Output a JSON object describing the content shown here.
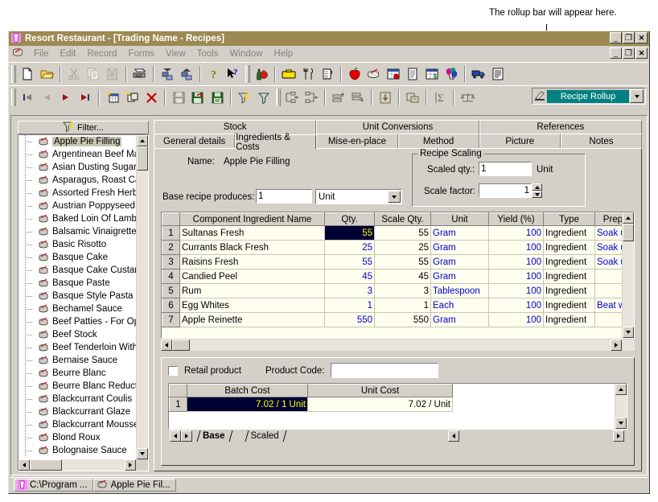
{
  "annotation": "The rollup bar will appear here.",
  "window": {
    "title": "Resort Restaurant - [Trading Name - Recipes]",
    "minimize": "_",
    "restore": "❐",
    "close": "✕"
  },
  "menu": {
    "items": [
      "File",
      "Edit",
      "Record",
      "Forms",
      "View",
      "Tools",
      "Window",
      "Help"
    ],
    "minimize": "_",
    "restore": "❐",
    "close": "✕"
  },
  "toolbar1": {
    "icons": [
      "new-document-icon",
      "open-folder-icon",
      "cut-scissors-icon",
      "copy-icon",
      "paste-icon",
      "print-preview-icon",
      "move-down-icon",
      "move-up-icon",
      "help-question-icon",
      "help-pointer-icon",
      "beverage-icon",
      "stock-box-icon",
      "cutlery-icon",
      "measuring-jug-icon",
      "apple-icon",
      "mixing-bowl-icon",
      "recipe-calendar-icon",
      "menu-book-icon",
      "cost-sheet-icon",
      "balloons-icon",
      "delivery-truck-icon",
      "report-icon"
    ]
  },
  "toolbar2": {
    "icons": [
      "first-record-icon",
      "previous-record-icon",
      "next-record-icon",
      "last-record-icon",
      "new-record-icon",
      "duplicate-record-icon",
      "delete-record-icon",
      "save-icon",
      "save-undo-icon",
      "save-print-icon",
      "filter-apply-icon",
      "filter-icon",
      "indent-left-icon",
      "indent-right-icon",
      "promote-icon",
      "demote-icon",
      "download-icon",
      "properties-icon",
      "sum-icon",
      "balance-icon"
    ]
  },
  "rollup": {
    "label": "Recipe Rollup",
    "dropdown": "↓",
    "icon": "rollup-pen-icon"
  },
  "tree": {
    "filter_label": "Filter...",
    "filter_icon": "filter-funnel-icon",
    "selected": "Apple Pie Filling",
    "items": [
      "Apple Pie Filling",
      "Argentinean Beef Matambre",
      "Asian Dusting Sugar",
      "Asparagus, Roast Capsicum",
      "Assorted Fresh Herbs, Fine",
      "Austrian Poppyseed Cake",
      "Baked Loin Of Lamb With C",
      "Balsamic Vinaigrette",
      "Basic Risotto",
      "Basque Cake",
      "Basque Cake Custard Filling",
      "Basque Paste",
      "Basque Style Pasta Piperad",
      "Bechamel Sauce",
      "Beef Patties - For Open Fac",
      "Beef Stock",
      "Beef Tenderloin With Seed",
      "Bernaise Sauce",
      "Beurre Blanc",
      "Beurre Blanc Reduction",
      "Blackcurrant Coulis",
      "Blackcurrant Glaze",
      "Blackcurrant Mousse",
      "Blond Roux",
      "Bolognaise Sauce"
    ]
  },
  "tabs_row1": [
    {
      "label": "Stock",
      "active": false
    },
    {
      "label": "Unit Conversions",
      "active": false
    },
    {
      "label": "References",
      "active": false
    }
  ],
  "tabs_row2": [
    {
      "label": "General details",
      "active": false
    },
    {
      "label": "Ingredients & Costs",
      "active": true
    },
    {
      "label": "Mise-en-place",
      "active": false
    },
    {
      "label": "Method",
      "active": false
    },
    {
      "label": "Picture",
      "active": false
    },
    {
      "label": "Notes",
      "active": false
    }
  ],
  "form": {
    "name_label": "Name:",
    "name_value": "Apple Pie Filling",
    "base_recipe_label": "Base recipe produces:",
    "base_recipe_qty": "1",
    "base_recipe_unit": "Unit",
    "scaling_title": "Recipe Scaling",
    "scaled_qty_label": "Scaled qty.:",
    "scaled_qty_value": "1",
    "scaled_qty_unit": "Unit",
    "scale_factor_label": "Scale factor:",
    "scale_factor_value": "1"
  },
  "grid": {
    "columns": [
      "Component Ingredient Name",
      "Qty.",
      "Scale Qty.",
      "Unit",
      "Yield (%)",
      "Type",
      "Prep."
    ],
    "rows": [
      {
        "n": "1",
        "name": "Sultanas Fresh",
        "qty": "55",
        "scale": "55",
        "unit": "Gram",
        "yield": "100",
        "type": "Ingredient",
        "prep": "Soak un"
      },
      {
        "n": "2",
        "name": "Currants Black Fresh",
        "qty": "25",
        "scale": "25",
        "unit": "Gram",
        "yield": "100",
        "type": "Ingredient",
        "prep": "Soak un"
      },
      {
        "n": "3",
        "name": "Raisins Fresh",
        "qty": "55",
        "scale": "55",
        "unit": "Gram",
        "yield": "100",
        "type": "Ingredient",
        "prep": "Soak un"
      },
      {
        "n": "4",
        "name": "Candied Peel",
        "qty": "45",
        "scale": "45",
        "unit": "Gram",
        "yield": "100",
        "type": "Ingredient",
        "prep": ""
      },
      {
        "n": "5",
        "name": "Rum",
        "qty": "3",
        "scale": "3",
        "unit": "Tablespoon",
        "yield": "100",
        "type": "Ingredient",
        "prep": ""
      },
      {
        "n": "6",
        "name": "Egg Whites",
        "qty": "1",
        "scale": "1",
        "unit": "Each",
        "yield": "100",
        "type": "Ingredient",
        "prep": "Beat we"
      },
      {
        "n": "7",
        "name": "Apple Reinette",
        "qty": "550",
        "scale": "550",
        "unit": "Gram",
        "yield": "100",
        "type": "Ingredient",
        "prep": ""
      }
    ],
    "selected_cell": {
      "row": 1,
      "column": "Qty.",
      "value": "55"
    }
  },
  "cost": {
    "retail_label": "Retail product",
    "retail_checked": false,
    "product_code_label": "Product Code:",
    "product_code_value": "",
    "columns": [
      "Batch Cost",
      "Unit Cost"
    ],
    "rows": [
      {
        "n": "1",
        "batch": "7.02 / 1 Unit",
        "unit": "7.02 / Unit"
      }
    ],
    "sheet_tabs": [
      {
        "label": "Base",
        "active": true
      },
      {
        "label": "Scaled",
        "active": false
      }
    ]
  },
  "taskbar": {
    "buttons": [
      {
        "label": "C:\\Program ...",
        "icon": "app-icon"
      },
      {
        "label": "Apple Pie Fil...",
        "icon": "recipe-pot-icon"
      }
    ]
  }
}
